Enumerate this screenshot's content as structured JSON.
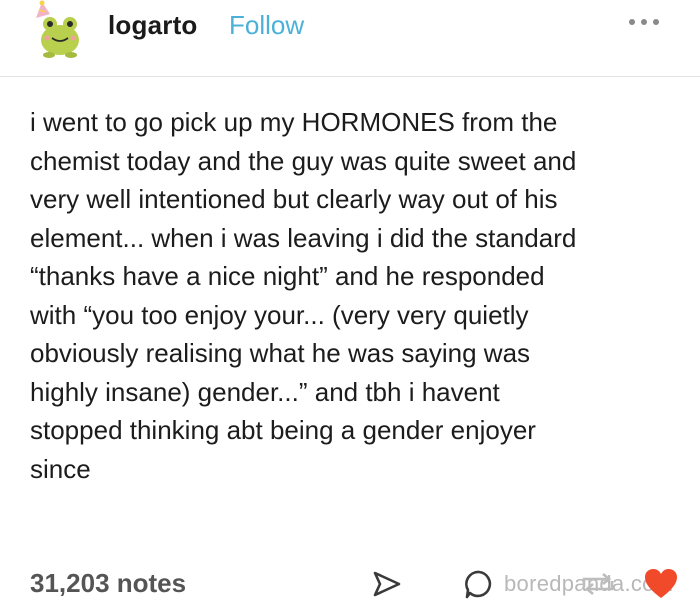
{
  "header": {
    "username": "logarto",
    "follow_label": "Follow",
    "avatar_icon": "frog-party-hat-icon",
    "more_icon": "more-options-icon"
  },
  "post": {
    "text": "i went to go pick up my HORMONES from the\nchemist today and the guy was quite sweet and\nvery well intentioned but clearly way out of his\nelement... when i was leaving i did the standard\n“thanks have a nice night” and he responded\nwith “you too enjoy your... (very very quietly\nobviously realising what he was saying was\nhighly insane) gender...” and tbh i havent\nstopped thinking abt being a gender enjoyer\nsince"
  },
  "footer": {
    "notes": "31,203 notes",
    "watermark": "boredpanda.com",
    "icons": [
      "share-icon",
      "reply-icon",
      "reblog-icon",
      "like-icon"
    ]
  },
  "colors": {
    "follow": "#4bb1d8",
    "heart": "#f04a2a",
    "text": "#1c1c1c",
    "notes": "#555555",
    "divider": "#e3e3e3"
  }
}
